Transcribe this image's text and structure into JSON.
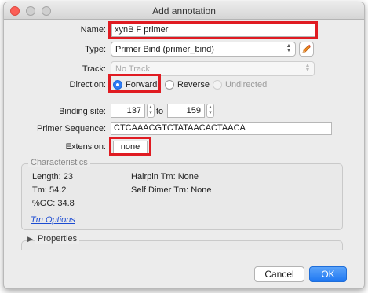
{
  "window": {
    "title": "Add annotation"
  },
  "form": {
    "name_label": "Name:",
    "name_value": "xynB F primer",
    "type_label": "Type:",
    "type_value": "Primer Bind (primer_bind)",
    "track_label": "Track:",
    "track_value": "No Track",
    "direction_label": "Direction:",
    "direction_options": [
      "Forward",
      "Reverse",
      "Undirected"
    ],
    "direction_selected": "Forward",
    "binding_label": "Binding site:",
    "binding_start": "137",
    "binding_to": "to",
    "binding_end": "159",
    "sequence_label": "Primer Sequence:",
    "sequence_value": "CTCAAACGTCTATAACACTAACA",
    "extension_label": "Extension:",
    "extension_value": "none"
  },
  "characteristics": {
    "title": "Characteristics",
    "length": "Length: 23",
    "tm": "Tm: 54.2",
    "gc": "%GC: 34.8",
    "hairpin": "Hairpin Tm: None",
    "self_dimer": "Self Dimer Tm: None",
    "tm_options_link": "Tm Options"
  },
  "properties": {
    "label": "Properties"
  },
  "buttons": {
    "cancel": "Cancel",
    "ok": "OK"
  },
  "icons": {
    "popup_arrows": "up-down-chevron",
    "edit": "pencil-icon",
    "disclosure": "right-triangle"
  },
  "colors": {
    "highlight_red": "#e01b22",
    "accent_blue": "#2d7bf4",
    "link_blue": "#1b4bd2"
  }
}
